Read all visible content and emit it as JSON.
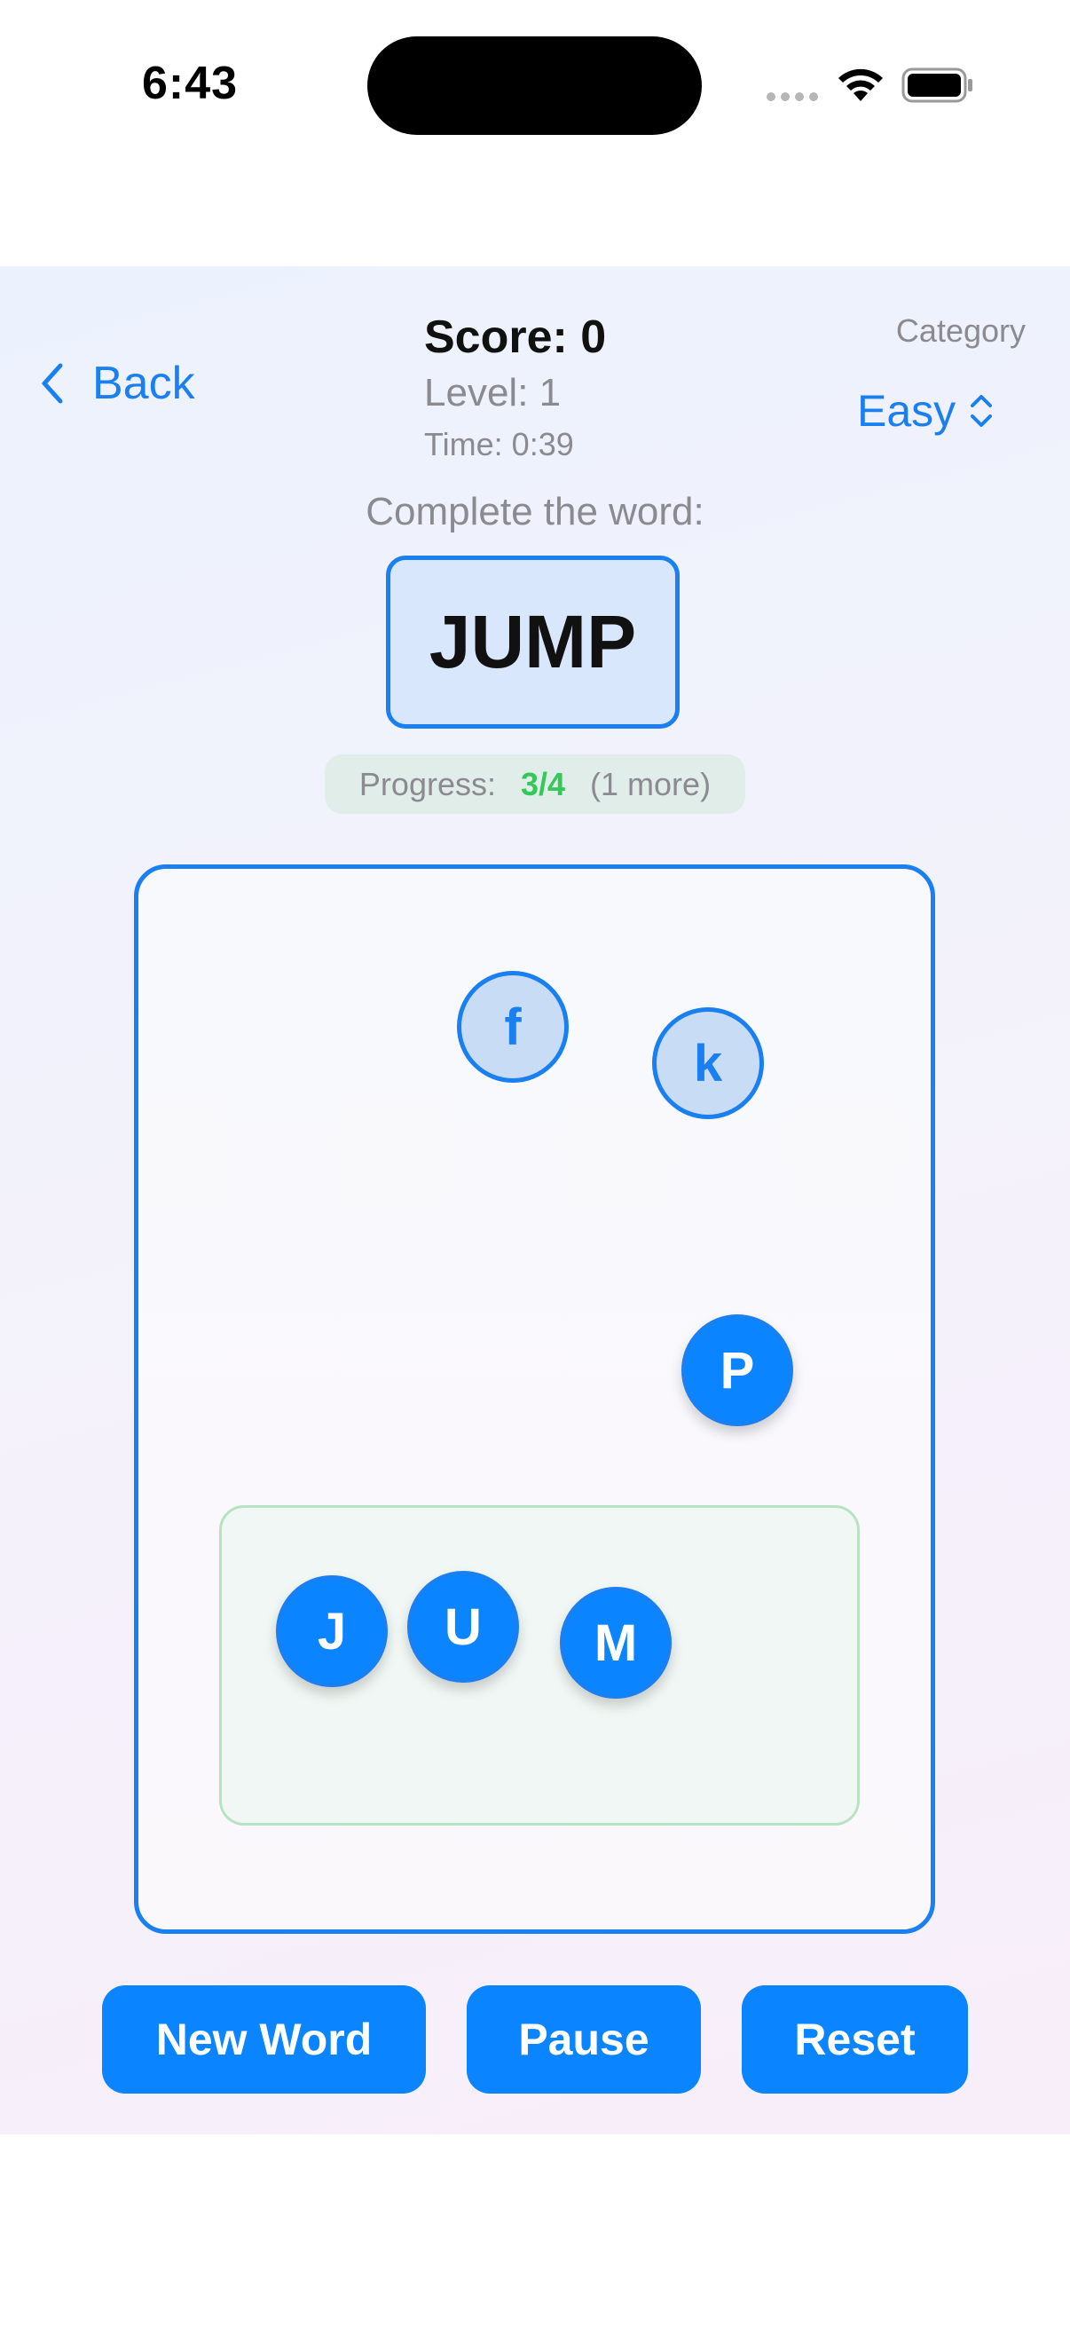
{
  "status_bar": {
    "time": "6:43"
  },
  "header": {
    "back_label": "Back",
    "score": "Score: 0",
    "level": "Level: 1",
    "time": "Time: 0:39",
    "category_label": "Category",
    "difficulty": "Easy"
  },
  "puzzle": {
    "prompt": "Complete the word:",
    "word": "JUMP",
    "progress_label": "Progress:",
    "progress_value": "3/4",
    "progress_note": "(1 more)"
  },
  "tiles": {
    "loose": [
      {
        "letter": "f",
        "style": "light"
      },
      {
        "letter": "k",
        "style": "light"
      },
      {
        "letter": "P",
        "style": "solid"
      }
    ],
    "placed": [
      {
        "letter": "J"
      },
      {
        "letter": "U"
      },
      {
        "letter": "M"
      }
    ]
  },
  "buttons": {
    "new_word": "New Word",
    "pause": "Pause",
    "reset": "Reset"
  },
  "colors": {
    "accent": "#0a84ff",
    "success": "#34c759"
  }
}
